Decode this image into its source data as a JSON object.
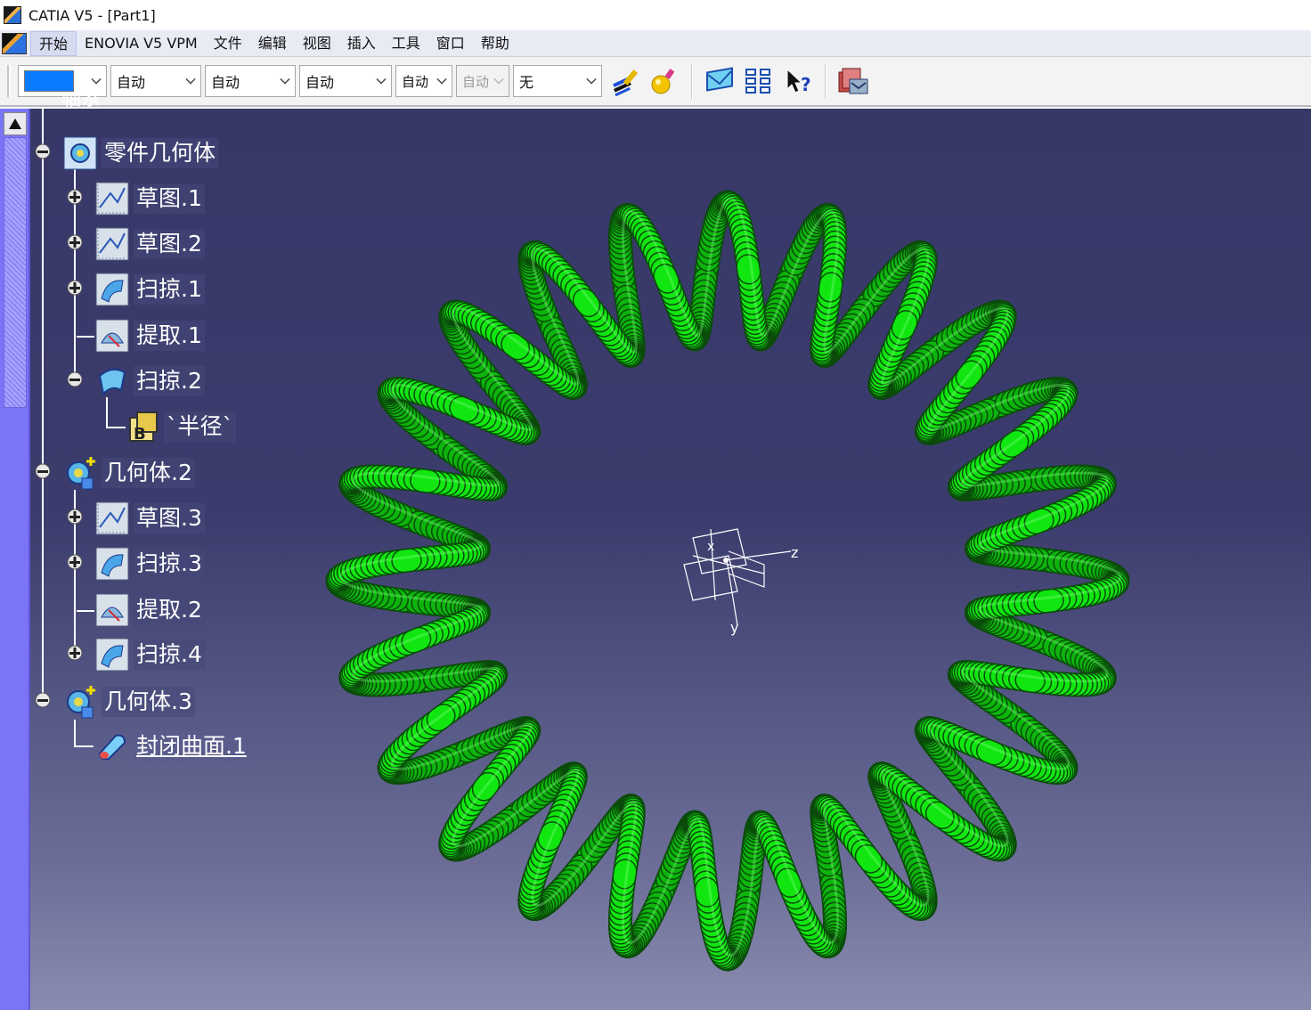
{
  "window": {
    "title": "CATIA V5 - [Part1]"
  },
  "menu": {
    "items": [
      "开始",
      "ENOVIA V5 VPM",
      "文件",
      "编辑",
      "视图",
      "插入",
      "工具",
      "窗口",
      "帮助"
    ],
    "active": "开始"
  },
  "toolbar": {
    "color_value": "#0a7bff",
    "combos": [
      {
        "value": "自动",
        "enabled": true
      },
      {
        "value": "自动",
        "enabled": true
      },
      {
        "value": "自动",
        "enabled": true
      },
      {
        "value": "自动",
        "enabled": true
      },
      {
        "value": "自动",
        "enabled": false
      },
      {
        "value": "无",
        "enabled": true
      }
    ],
    "icons": [
      "brush-icon",
      "light-bulb-icon",
      "envelope-icon",
      "grid-icon",
      "whats-this-help-icon",
      "catalog-icon"
    ]
  },
  "tree": {
    "top_partial": "轴系",
    "nodes": [
      {
        "label": "零件几何体",
        "icon": "body-icon",
        "expander": "minus"
      },
      {
        "label": "草图.1",
        "icon": "sketch-icon",
        "expander": "plus"
      },
      {
        "label": "草图.2",
        "icon": "sketch-icon",
        "expander": "plus"
      },
      {
        "label": "扫掠.1",
        "icon": "sweep-icon",
        "expander": "plus"
      },
      {
        "label": "提取.1",
        "icon": "extract-icon",
        "expander": "none"
      },
      {
        "label": "扫掠.2",
        "icon": "sweep-surface-icon",
        "expander": "minus"
      },
      {
        "label": "`半径`",
        "icon": "parameter-icon",
        "expander": "none"
      },
      {
        "label": "几何体.2",
        "icon": "geometrical-set-icon",
        "expander": "minus"
      },
      {
        "label": "草图.3",
        "icon": "sketch-icon",
        "expander": "plus"
      },
      {
        "label": "扫掠.3",
        "icon": "sweep-icon",
        "expander": "plus"
      },
      {
        "label": "提取.2",
        "icon": "extract-icon",
        "expander": "none"
      },
      {
        "label": "扫掠.4",
        "icon": "sweep-icon",
        "expander": "plus"
      },
      {
        "label": "几何体.3",
        "icon": "geometrical-set-icon",
        "expander": "minus"
      },
      {
        "label": "封闭曲面.1",
        "icon": "close-surface-icon",
        "expander": "none",
        "selected": true
      }
    ]
  },
  "viewport": {
    "model_color": "#11e611",
    "axis_labels": {
      "x": "x",
      "y": "y",
      "z": "z"
    }
  }
}
